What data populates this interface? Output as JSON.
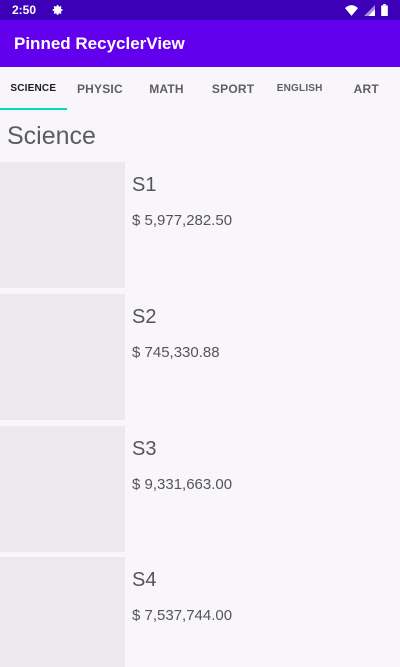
{
  "status_bar": {
    "time": "2:50",
    "icons": [
      "gear-icon",
      "wifi-icon",
      "signal-icon",
      "battery-icon"
    ]
  },
  "app_bar": {
    "title": "Pinned RecyclerView"
  },
  "tabs": [
    {
      "label": "SCIENCE",
      "selected": true
    },
    {
      "label": "PHYSIC",
      "selected": false
    },
    {
      "label": "MATH",
      "selected": false
    },
    {
      "label": "SPORT",
      "selected": false
    },
    {
      "label": "ENGLISH",
      "selected": false
    },
    {
      "label": "ART",
      "selected": false
    }
  ],
  "section": {
    "title": "Science"
  },
  "items": [
    {
      "name": "S1",
      "price": "$ 5,977,282.50"
    },
    {
      "name": "S2",
      "price": "$ 745,330.88"
    },
    {
      "name": "S3",
      "price": "$ 9,331,663.00"
    },
    {
      "name": "S4",
      "price": "$ 7,537,744.00"
    }
  ],
  "colors": {
    "status_bar": "#3b00b8",
    "app_bar": "#6200ee",
    "tab_indicator": "#03dac5"
  }
}
